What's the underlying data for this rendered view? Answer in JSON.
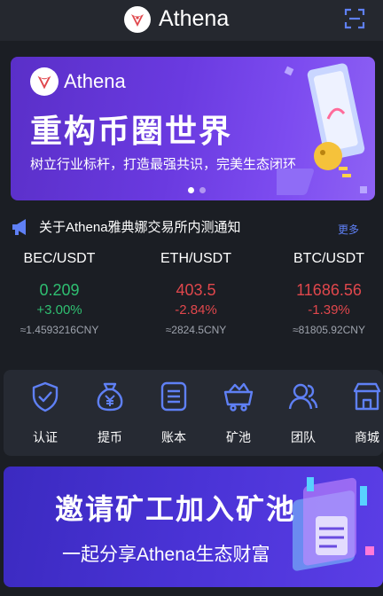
{
  "header": {
    "title": "Athena"
  },
  "banner": {
    "brand": "Athena",
    "headline": "重构币圈世界",
    "subtitle": "树立行业标杆，打造最强共识，完美生态闭环",
    "slide_count": 2,
    "active_slide": 1
  },
  "notice": {
    "text": "关于Athena雅典娜交易所内测通知",
    "more": "更多"
  },
  "tickers": [
    {
      "pair": "BEC/USDT",
      "price": "0.209",
      "change": "+3.00%",
      "cny": "≈1.4593216CNY",
      "trend": "up"
    },
    {
      "pair": "ETH/USDT",
      "price": "403.5",
      "change": "-2.84%",
      "cny": "≈2824.5CNY",
      "trend": "down"
    },
    {
      "pair": "BTC/USDT",
      "price": "11686.56",
      "change": "-1.39%",
      "cny": "≈81805.92CNY",
      "trend": "down"
    }
  ],
  "menu": [
    {
      "label": "认证",
      "icon": "shield-check-icon"
    },
    {
      "label": "提币",
      "icon": "money-bag-icon"
    },
    {
      "label": "账本",
      "icon": "ledger-icon"
    },
    {
      "label": "矿池",
      "icon": "mine-cart-icon"
    },
    {
      "label": "团队",
      "icon": "team-icon"
    },
    {
      "label": "商城",
      "icon": "shop-icon"
    }
  ],
  "promo": {
    "title": "邀请矿工加入矿池",
    "subtitle": "一起分享Athena生态财富"
  },
  "colors": {
    "up": "#2fbf71",
    "down": "#e0474c",
    "accent": "#5f80f5",
    "banner": "#6a3ae0"
  }
}
